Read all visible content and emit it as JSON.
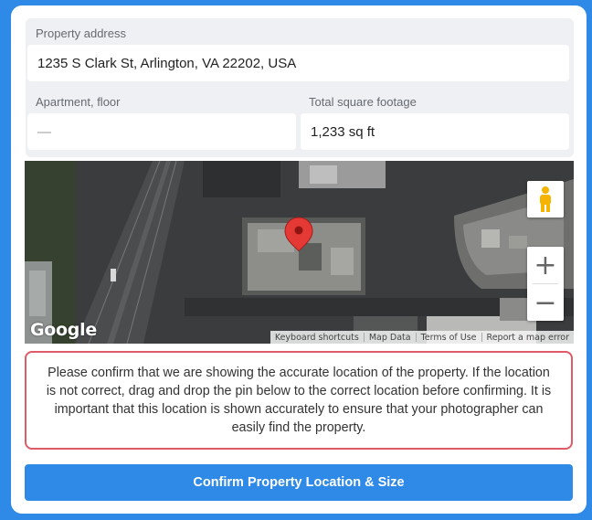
{
  "form": {
    "address_label": "Property address",
    "address_value": "1235 S Clark St, Arlington, VA 22202, USA",
    "apartment_label": "Apartment, floor",
    "apartment_placeholder": "—",
    "footage_label": "Total square footage",
    "footage_value": "1,233 sq ft"
  },
  "map": {
    "logo": "Google",
    "zoom_in": "+",
    "zoom_out": "−",
    "attribution": [
      "Keyboard shortcuts",
      "Map Data",
      "Terms of Use",
      "Report a map error"
    ],
    "pin_color": "#e53935",
    "street_view_icon": "pegman-icon"
  },
  "notice": {
    "text": "Please confirm that we are showing the accurate location of the property. If the location is not correct, drag and drop the pin below to the correct location before confirming. It is important that this location is shown accurately to ensure that your photographer can easily find the property."
  },
  "actions": {
    "confirm_label": "Confirm Property Location & Size"
  },
  "colors": {
    "accent": "#2e8ae6",
    "notice_border": "#e05a67"
  }
}
